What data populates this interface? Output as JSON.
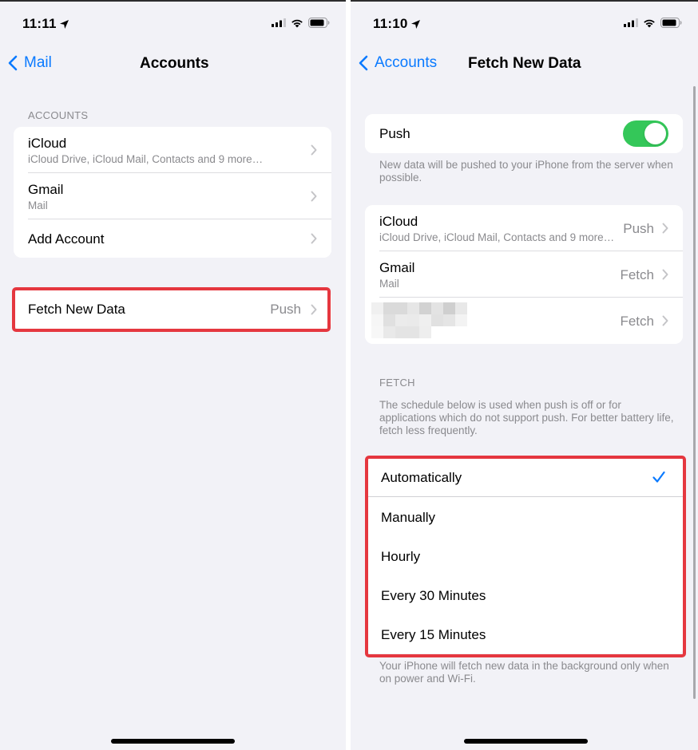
{
  "colors": {
    "accent": "#0a7aff",
    "toggle_on": "#34c759",
    "highlight": "#e5373f",
    "background": "#f2f2f7",
    "secondary_text": "#8a8a8e"
  },
  "left": {
    "status": {
      "time": "11:11",
      "icons": [
        "location-arrow-icon",
        "cellular-signal-icon",
        "wifi-icon",
        "battery-icon"
      ]
    },
    "nav": {
      "back_label": "Mail",
      "title": "Accounts"
    },
    "accounts_header": "ACCOUNTS",
    "accounts": [
      {
        "title": "iCloud",
        "subtitle": "iCloud Drive, iCloud Mail, Contacts and 9 more…"
      },
      {
        "title": "Gmail",
        "subtitle": "Mail"
      },
      {
        "title": "Add Account",
        "subtitle": ""
      }
    ],
    "fetch_row": {
      "title": "Fetch New Data",
      "value": "Push"
    }
  },
  "right": {
    "status": {
      "time": "11:10",
      "icons": [
        "location-arrow-icon",
        "cellular-signal-icon",
        "wifi-icon",
        "battery-icon"
      ]
    },
    "nav": {
      "back_label": "Accounts",
      "title": "Fetch New Data"
    },
    "push": {
      "label": "Push",
      "enabled": true,
      "footer": "New data will be pushed to your iPhone from the server when possible."
    },
    "accounts": [
      {
        "title": "iCloud",
        "subtitle": "iCloud Drive, iCloud Mail, Contacts and 9 more…",
        "value": "Push"
      },
      {
        "title": "Gmail",
        "subtitle": "Mail",
        "value": "Fetch"
      },
      {
        "title": "",
        "subtitle": "",
        "value": "Fetch",
        "redacted": true
      }
    ],
    "fetch_header": "FETCH",
    "fetch_description": "The schedule below is used when push is off or for applications which do not support push. For better battery life, fetch less frequently.",
    "schedule_options": [
      {
        "label": "Automatically",
        "selected": true
      },
      {
        "label": "Manually",
        "selected": false
      },
      {
        "label": "Hourly",
        "selected": false
      },
      {
        "label": "Every 30 Minutes",
        "selected": false
      },
      {
        "label": "Every 15 Minutes",
        "selected": false
      }
    ],
    "schedule_footer": "Your iPhone will fetch new data in the background only when on power and Wi-Fi."
  }
}
